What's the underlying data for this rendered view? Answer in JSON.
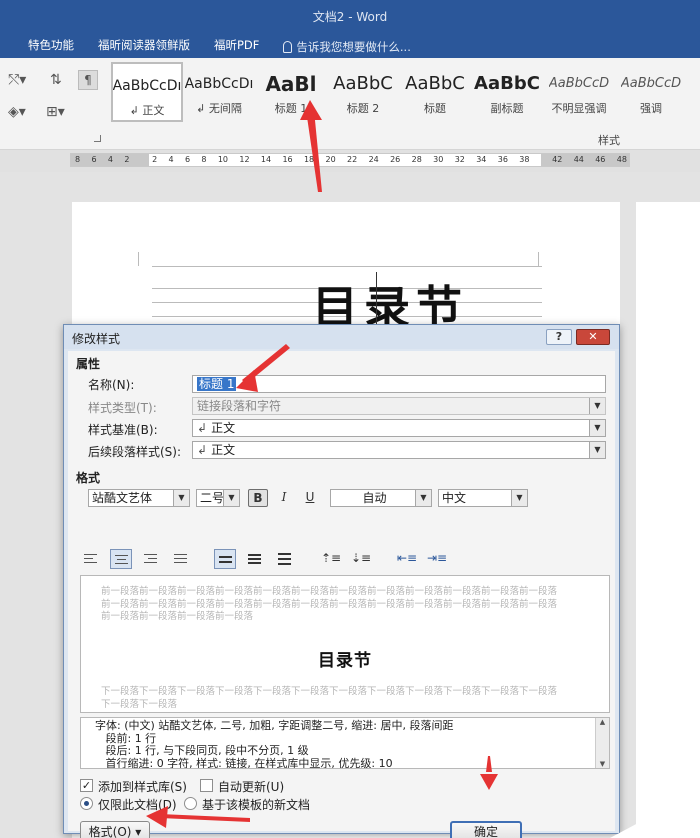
{
  "window": {
    "title": "文档2 - Word"
  },
  "ribbon_tabs": [
    "特色功能",
    "福昕阅读器领鲜版",
    "福昕PDF"
  ],
  "tell_me": "告诉我您想要做什么...",
  "styles_gallery": [
    {
      "sample": "AaBbCcDı",
      "name": "↲ 正文"
    },
    {
      "sample": "AaBbCcDı",
      "name": "↲ 无间隔"
    },
    {
      "sample": "AaBl",
      "name": "标题 1"
    },
    {
      "sample": "AaBbC",
      "name": "标题 2"
    },
    {
      "sample": "AaBbC",
      "name": "标题"
    },
    {
      "sample": "AaBbC",
      "name": "副标题"
    },
    {
      "sample": "AaBbCcD",
      "name": "不明显强调"
    },
    {
      "sample": "AaBbCcD",
      "name": "强调"
    }
  ],
  "styles_group_label": "样式",
  "ruler_numbers": [
    "8",
    "6",
    "4",
    "2",
    "",
    "2",
    "4",
    "6",
    "8",
    "10",
    "12",
    "14",
    "16",
    "18",
    "20",
    "22",
    "24",
    "26",
    "28",
    "30",
    "32",
    "34",
    "36",
    "38",
    "",
    "42",
    "44",
    "46",
    "48"
  ],
  "document": {
    "heading": "目录节"
  },
  "dialog": {
    "title": "修改样式",
    "help": "?",
    "close": "✕",
    "properties_label": "属性",
    "name_label": "名称(N):",
    "name_value": "标题 1",
    "type_label": "样式类型(T):",
    "type_value": "链接段落和字符",
    "based_on_label": "样式基准(B):",
    "based_on_value": "正文",
    "next_label": "后续段落样式(S):",
    "next_value": "正文",
    "format_label": "格式",
    "font": "站酷文艺体",
    "size": "二号",
    "bold": "B",
    "italic": "I",
    "underline": "U",
    "color": "自动",
    "script": "中文",
    "preview_before": "前一段落前一段落前一段落前一段落前一段落前一段落前一段落前一段落前一段落前一段落前一段落前一段落前一段落前一段落前一段落前一段落前一段落前一段落前一段落前一段落前一段落前一段落前一段落前一段落前一段落前一段落前一段落前一段落",
    "preview_heading": "目录节",
    "preview_after": "下一段落下一段落下一段落下一段落下一段落下一段落下一段落下一段落下一段落下一段落下一段落下一段落下一段落下一段落",
    "description": "字体: (中文) 站酷文艺体, 二号, 加粗, 字距调整二号, 缩进: 居中, 段落间距\n   段前: 1 行\n   段后: 1 行, 与下段同页, 段中不分页, 1 级\n   首行缩进: 0 字符, 样式: 链接, 在样式库中显示, 优先级: 10",
    "add_to_gallery": "添加到样式库(S)",
    "auto_update": "自动更新(U)",
    "only_this_doc": "仅限此文档(D)",
    "new_docs_template": "基于该模板的新文档",
    "format_button": "格式(O) ▾",
    "ok_button": "确定"
  },
  "colors": {
    "title_bar": "#2b579a",
    "annotation_arrow": "#e53333",
    "selection": "#3776c9"
  }
}
